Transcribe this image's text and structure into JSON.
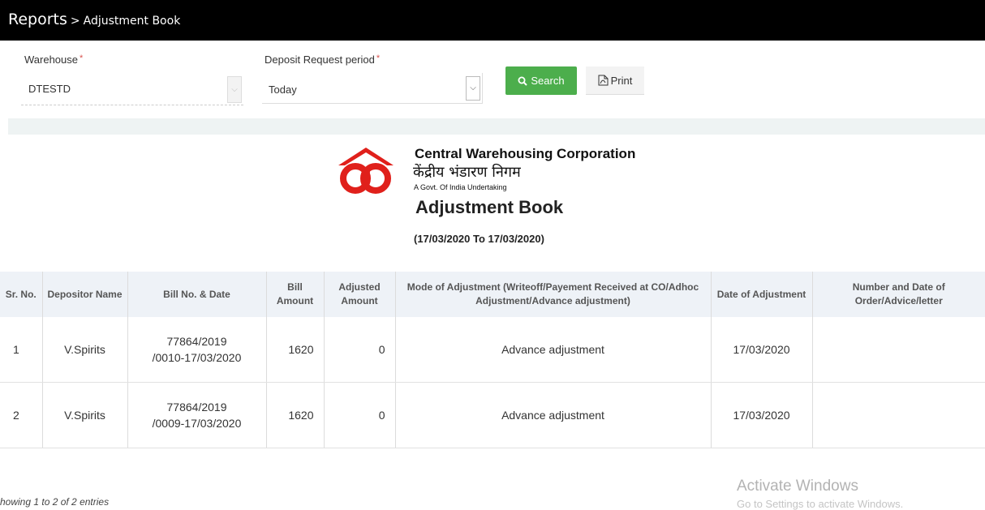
{
  "breadcrumb": {
    "root": "Reports",
    "separator": ">",
    "current": "Adjustment Book"
  },
  "filters": {
    "warehouse_label": "Warehouse",
    "warehouse_value": "DTESTD",
    "period_label": "Deposit Request period",
    "period_value": "Today",
    "required_mark": "*"
  },
  "buttons": {
    "search": "Search",
    "print": "Print"
  },
  "report": {
    "org_name": "Central Warehousing Corporation",
    "org_name_hindi": "केंद्रीय भंडारण निगम",
    "org_tagline": "A Govt. Of India Undertaking",
    "title": "Adjustment Book",
    "period": "(17/03/2020 To 17/03/2020)"
  },
  "table": {
    "headers": [
      "Sr. No.",
      "Depositor Name",
      "Bill No. & Date",
      "Bill Amount",
      "Adjusted Amount",
      "Mode of Adjustment (Writeoff/Payement Received at CO/Adhoc Adjustment/Advance adjustment)",
      "Date of Adjustment",
      "Number and Date of Order/Advice/letter"
    ],
    "rows": [
      {
        "sr": "1",
        "depositor": "V.Spirits",
        "bill_line1": "77864/2019",
        "bill_line2": "/0010-17/03/2020",
        "bill_amount": "1620",
        "adjusted_amount": "0",
        "mode": "Advance adjustment",
        "date": "17/03/2020",
        "order": ""
      },
      {
        "sr": "2",
        "depositor": "V.Spirits",
        "bill_line1": "77864/2019",
        "bill_line2": "/0009-17/03/2020",
        "bill_amount": "1620",
        "adjusted_amount": "0",
        "mode": "Advance adjustment",
        "date": "17/03/2020",
        "order": ""
      }
    ]
  },
  "footer": {
    "info": "howing 1 to 2 of 2 entries"
  },
  "watermark": {
    "line1": "Activate Windows",
    "line2": "Go to Settings to activate Windows."
  },
  "colors": {
    "topbar": "#000000",
    "search_button": "#4cae4c",
    "header_bg": "#eef2f7",
    "logo_red": "#e0201b"
  }
}
